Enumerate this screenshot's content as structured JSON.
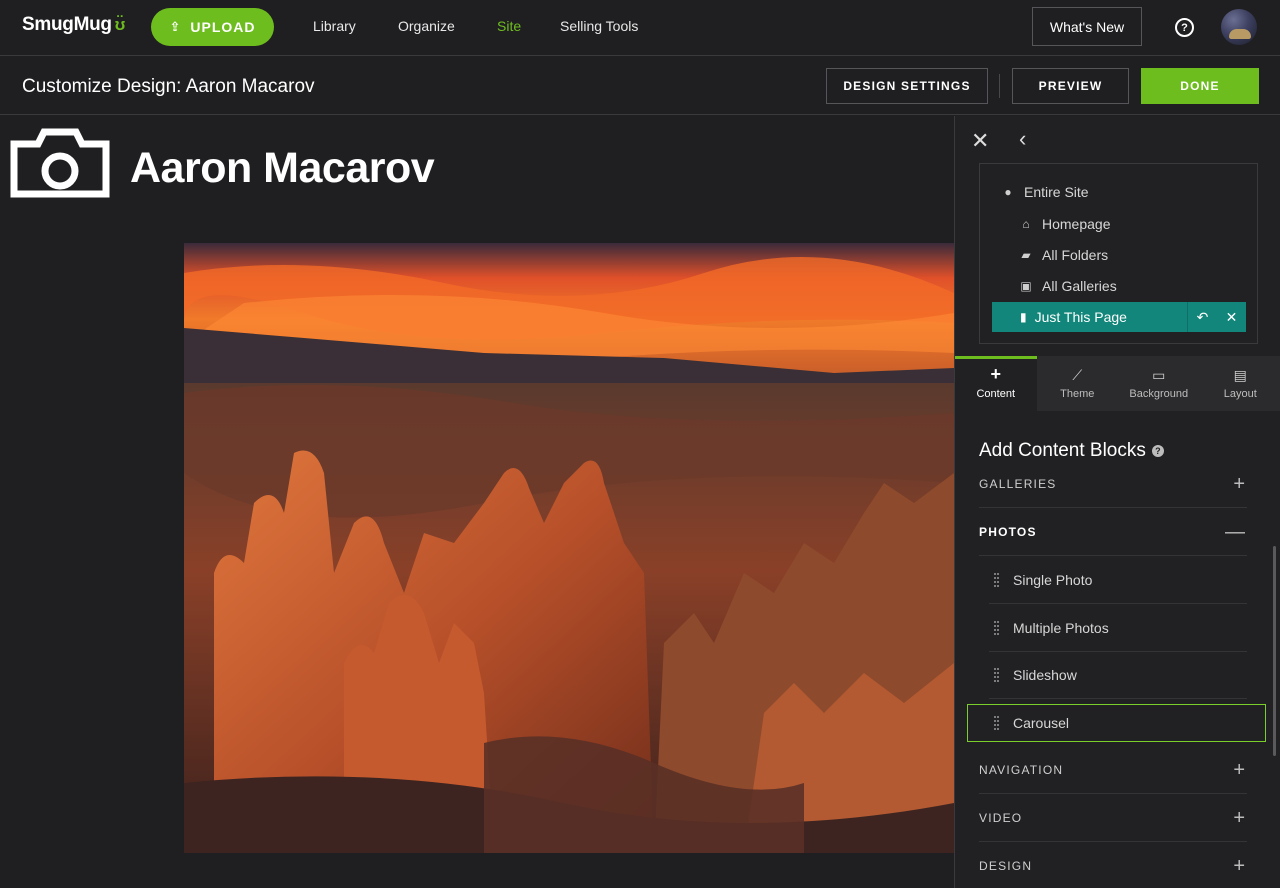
{
  "topnav": {
    "logo_text": "SmugMug",
    "logo_face": "ʊ̈",
    "upload_label": "UPLOAD",
    "items": [
      {
        "label": "Library",
        "active": false
      },
      {
        "label": "Organize",
        "active": false
      },
      {
        "label": "Site",
        "active": true
      },
      {
        "label": "Selling Tools",
        "active": false
      }
    ],
    "whats_new_label": "What's New",
    "help_glyph": "?"
  },
  "subheader": {
    "title": "Customize Design: Aaron Macarov",
    "design_settings_label": "DESIGN SETTINGS",
    "preview_label": "PREVIEW",
    "done_label": "DONE"
  },
  "canvas": {
    "site_name": "Aaron Macarov"
  },
  "sidebar": {
    "close_glyph": "✕",
    "back_glyph": "‹",
    "scope": {
      "items": [
        {
          "label": "Entire Site",
          "icon": "globe-icon",
          "glyph": "●"
        },
        {
          "label": "Homepage",
          "icon": "home-icon",
          "glyph": "⌂"
        },
        {
          "label": "All Folders",
          "icon": "folders-icon",
          "glyph": "▰"
        },
        {
          "label": "All Galleries",
          "icon": "galleries-icon",
          "glyph": "▣"
        }
      ],
      "active": {
        "label": "Just This Page",
        "icon": "page-icon",
        "glyph": "▮",
        "undo_glyph": "↶",
        "clear_glyph": "✕"
      }
    },
    "tabs": [
      {
        "label": "Content",
        "icon": "plus-icon",
        "glyph": "+",
        "active": true
      },
      {
        "label": "Theme",
        "icon": "brush-icon",
        "glyph": "⟋",
        "active": false
      },
      {
        "label": "Background",
        "icon": "monitor-icon",
        "glyph": "▭",
        "active": false
      },
      {
        "label": "Layout",
        "icon": "layout-icon",
        "glyph": "▤",
        "active": false
      }
    ],
    "add_blocks_title": "Add Content Blocks",
    "help_glyph": "?",
    "sections": {
      "galleries": {
        "label": "GALLERIES",
        "sign": "+"
      },
      "photos": {
        "label": "PHOTOS",
        "sign": "—"
      },
      "navigation": {
        "label": "NAVIGATION",
        "sign": "+"
      },
      "video": {
        "label": "VIDEO",
        "sign": "+"
      },
      "design": {
        "label": "DESIGN",
        "sign": "+"
      }
    },
    "photo_blocks": [
      "Single Photo",
      "Multiple Photos",
      "Slideshow",
      "Carousel"
    ]
  },
  "colors": {
    "accent_green": "#6ebd1f",
    "scope_teal": "#12867a",
    "background": "#1f1f21"
  }
}
